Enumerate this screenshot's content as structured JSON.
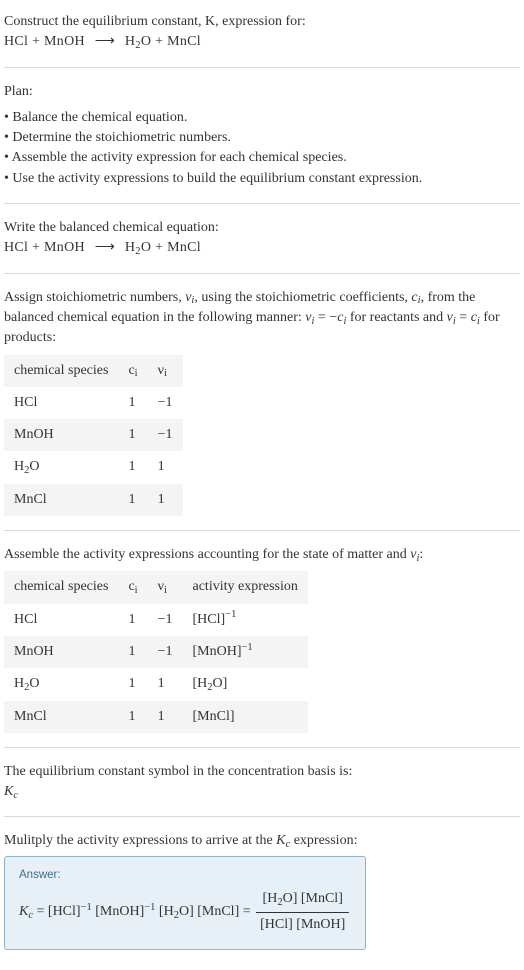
{
  "header": {
    "line1": "Construct the equilibrium constant, K, expression for:",
    "equation_html": "HCl + MnOH <span class=\"arrow\">⟶</span> H<sub>2</sub>O + MnCl"
  },
  "plan": {
    "title": "Plan:",
    "items": [
      "• Balance the chemical equation.",
      "• Determine the stoichiometric numbers.",
      "• Assemble the activity expression for each chemical species.",
      "• Use the activity expressions to build the equilibrium constant expression."
    ]
  },
  "balanced": {
    "title": "Write the balanced chemical equation:",
    "equation_html": "HCl + MnOH <span class=\"arrow\">⟶</span> H<sub>2</sub>O + MnCl"
  },
  "stoich": {
    "text_html": "Assign stoichiometric numbers, <span class=\"ital\">ν<sub>i</sub></span>, using the stoichiometric coefficients, <span class=\"ital\">c<sub>i</sub></span>, from the balanced chemical equation in the following manner: <span class=\"ital\">ν<sub>i</sub></span> = −<span class=\"ital\">c<sub>i</sub></span> for reactants and <span class=\"ital\">ν<sub>i</sub></span> = <span class=\"ital\">c<sub>i</sub></span> for products:",
    "table": {
      "headers": [
        "chemical species",
        "c<sub>i</sub>",
        "ν<sub>i</sub>"
      ],
      "rows": [
        [
          "HCl",
          "1",
          "−1"
        ],
        [
          "MnOH",
          "1",
          "−1"
        ],
        [
          "H<sub>2</sub>O",
          "1",
          "1"
        ],
        [
          "MnCl",
          "1",
          "1"
        ]
      ]
    }
  },
  "activity": {
    "title_html": "Assemble the activity expressions accounting for the state of matter and <span class=\"ital\">ν<sub>i</sub></span>:",
    "table": {
      "headers": [
        "chemical species",
        "c<sub>i</sub>",
        "ν<sub>i</sub>",
        "activity expression"
      ],
      "rows": [
        [
          "HCl",
          "1",
          "−1",
          "[HCl]<sup>−1</sup>"
        ],
        [
          "MnOH",
          "1",
          "−1",
          "[MnOH]<sup>−1</sup>"
        ],
        [
          "H<sub>2</sub>O",
          "1",
          "1",
          "[H<sub>2</sub>O]"
        ],
        [
          "MnCl",
          "1",
          "1",
          "[MnCl]"
        ]
      ]
    }
  },
  "symbol": {
    "title": "The equilibrium constant symbol in the concentration basis is:",
    "value_html": "<span class=\"ital\">K<sub>c</sub></span>"
  },
  "multiply": {
    "title_html": "Mulitply the activity expressions to arrive at the <span class=\"ital\">K<sub>c</sub></span> expression:"
  },
  "answer": {
    "label": "Answer:",
    "lhs_html": "<span class=\"ital\">K<sub>c</sub></span> = [HCl]<sup>−1</sup> [MnOH]<sup>−1</sup> [H<sub>2</sub>O] [MnCl] = ",
    "num_html": "[H<sub>2</sub>O] [MnCl]",
    "den_html": "[HCl] [MnOH]"
  }
}
